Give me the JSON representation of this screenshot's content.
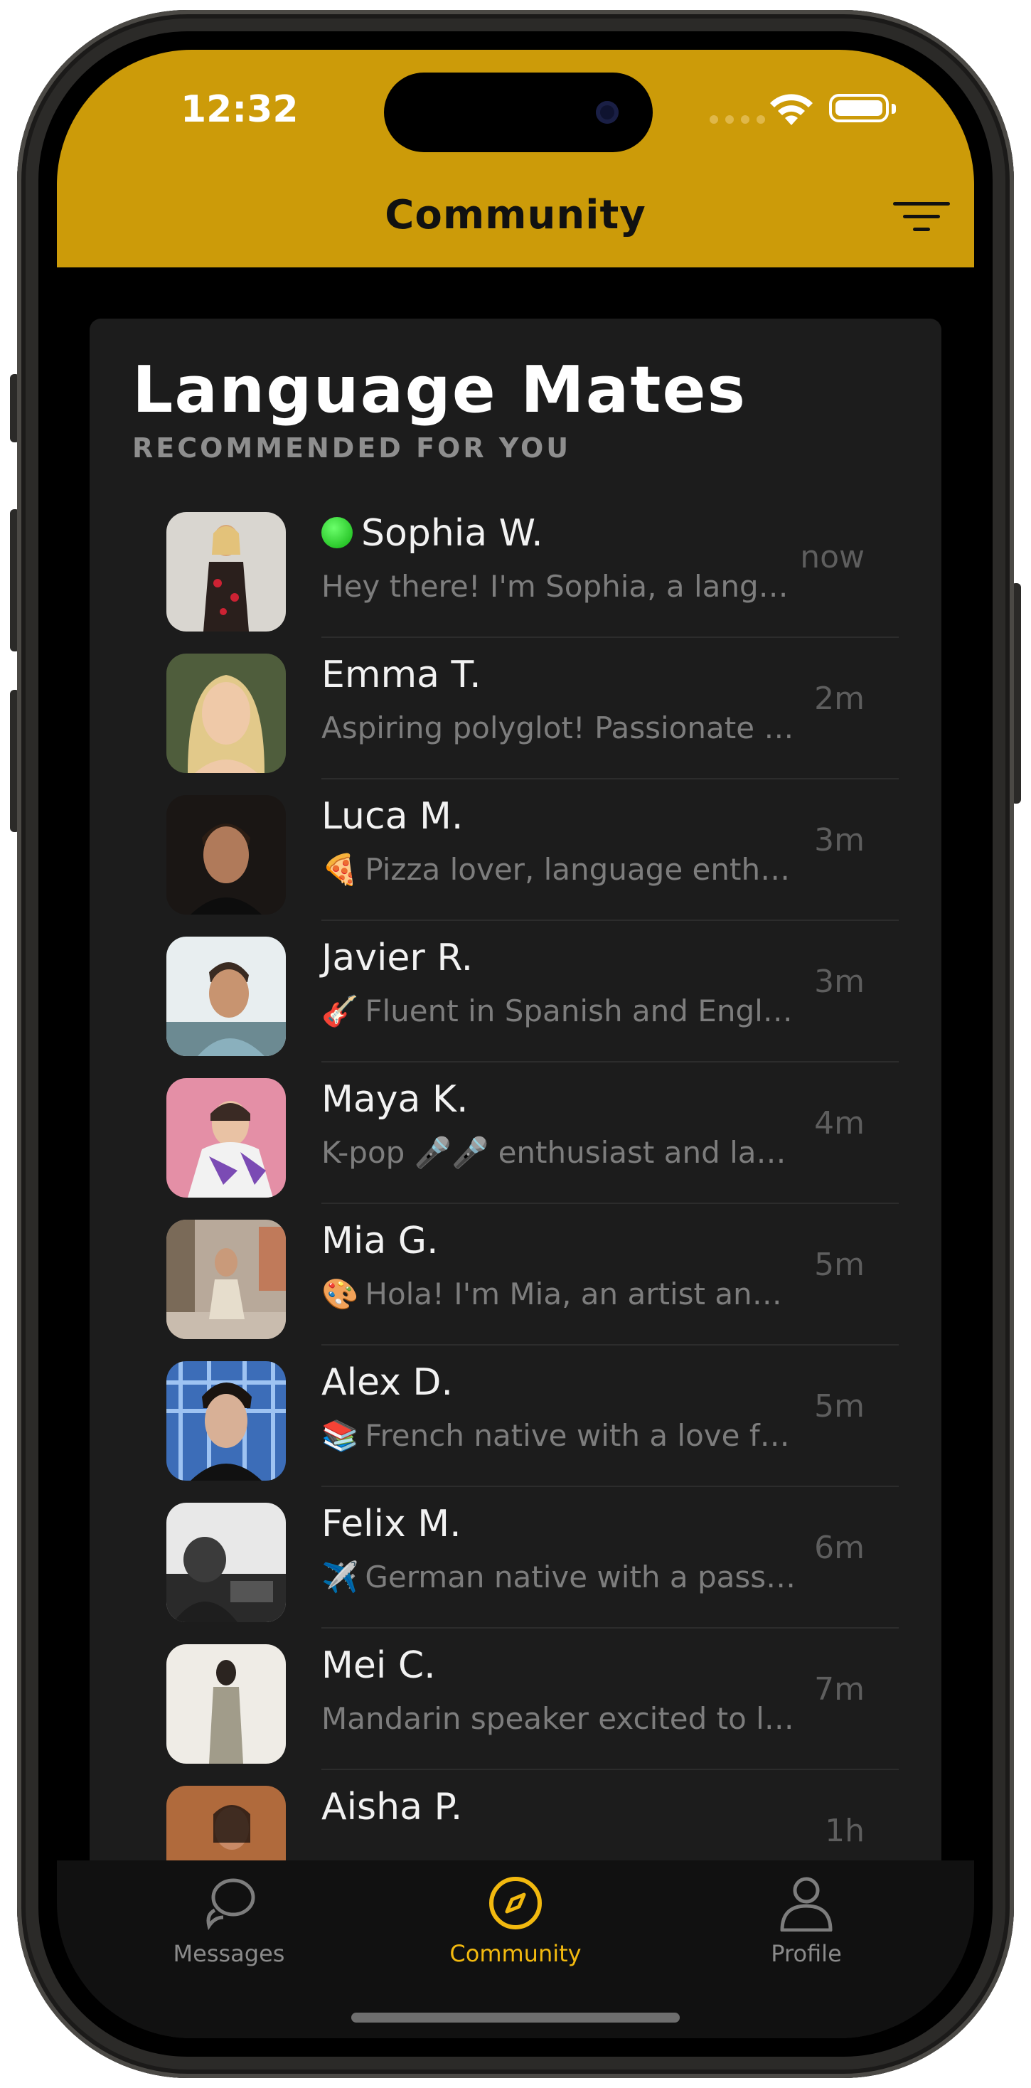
{
  "status": {
    "time": "12:32"
  },
  "header": {
    "title": "Community"
  },
  "card": {
    "title": "Language Mates",
    "subtitle": "RECOMMENDED FOR YOU"
  },
  "mates": [
    {
      "name": "Sophia W.",
      "preview": "Hey there! I'm Sophia, a language enthusiast",
      "time": "now",
      "online": true,
      "emoji": ""
    },
    {
      "name": "Emma T.",
      "preview": "Aspiring polyglot! Passionate about languages",
      "time": "2m",
      "emoji": ""
    },
    {
      "name": "Luca M.",
      "preview": "Pizza lover, language enthusiast",
      "time": "3m",
      "emoji": "🍕"
    },
    {
      "name": "Javier R.",
      "preview": "Fluent in Spanish and English",
      "time": "3m",
      "emoji": "🎸"
    },
    {
      "name": "Maya K.",
      "preview": "K-pop 🎤🎤 enthusiast and language learner",
      "time": "4m",
      "emoji": ""
    },
    {
      "name": "Mia G.",
      "preview": "Hola! I'm Mia, an artist and traveler",
      "time": "5m",
      "emoji": "🎨"
    },
    {
      "name": "Alex D.",
      "preview": "French native with a love for books",
      "time": "5m",
      "emoji": "📚"
    },
    {
      "name": "Felix M.",
      "preview": "German native with a passion for flying",
      "time": "6m",
      "emoji": "✈️"
    },
    {
      "name": "Mei C.",
      "preview": "Mandarin speaker excited to learn",
      "time": "7m",
      "emoji": ""
    },
    {
      "name": "Aisha P.",
      "preview": "",
      "time": "1h",
      "emoji": ""
    }
  ],
  "tabs": [
    {
      "label": "Messages",
      "icon": "chat-bubbles-icon"
    },
    {
      "label": "Community",
      "icon": "compass-icon",
      "active": true
    },
    {
      "label": "Profile",
      "icon": "person-icon"
    }
  ],
  "colors": {
    "header": "#cc9b09",
    "accent": "#f2b90f",
    "card": "#1c1c1c",
    "online": "#10b010"
  }
}
